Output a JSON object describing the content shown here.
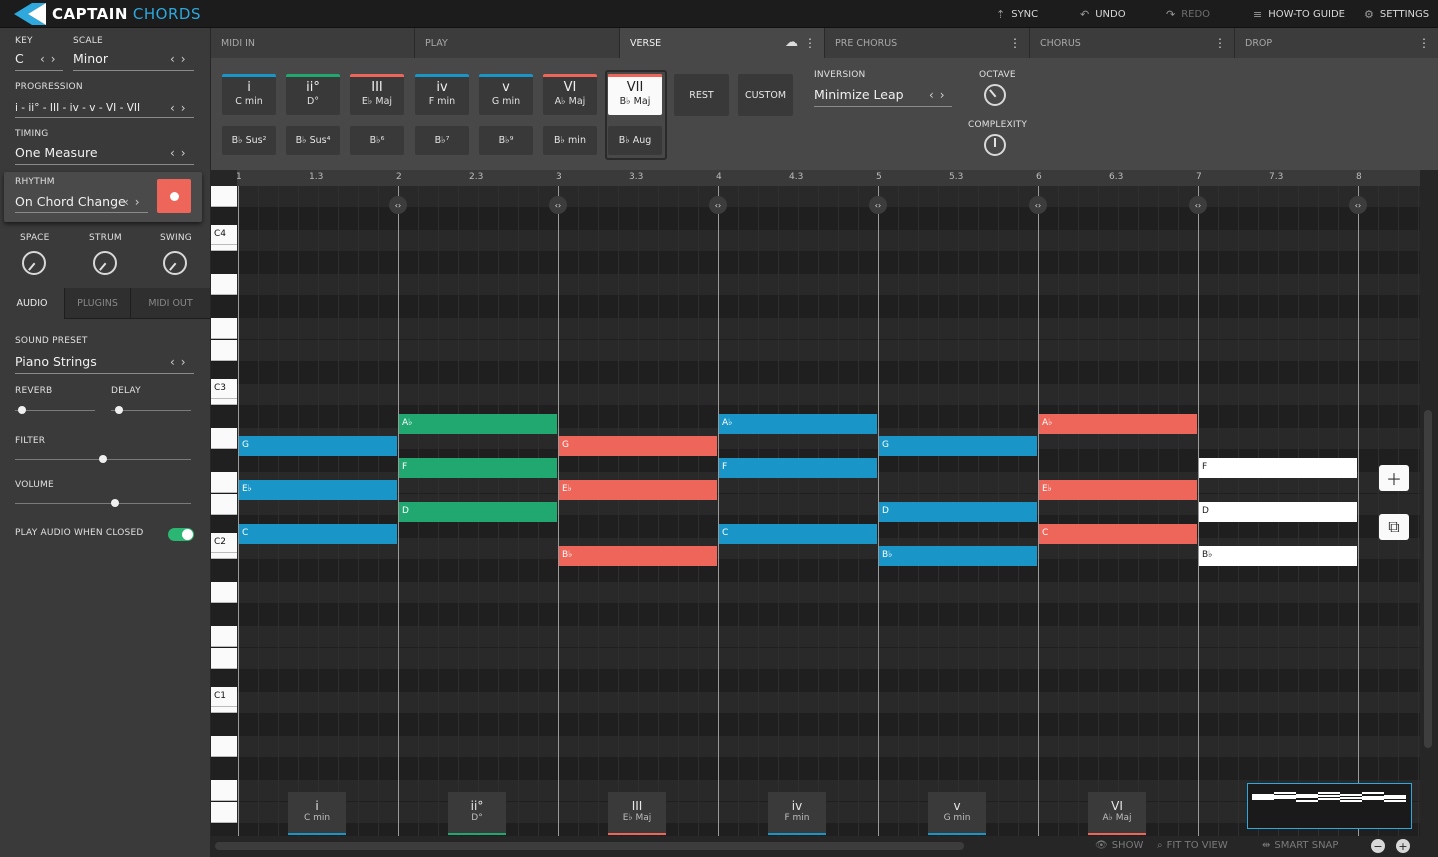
{
  "app": {
    "name_part1": "CAPTAIN",
    "name_part2": "CHORDS"
  },
  "topbar": {
    "sync": "SYNC",
    "undo": "UNDO",
    "redo": "REDO",
    "guide": "HOW-TO GUIDE",
    "settings": "SETTINGS"
  },
  "left": {
    "key_label": "KEY",
    "key_value": "C",
    "scale_label": "SCALE",
    "scale_value": "Minor",
    "progression_label": "PROGRESSION",
    "progression_value": "i - ii° - III - iv - v - VI - VII",
    "timing_label": "TIMING",
    "timing_value": "One Measure",
    "rhythm_label": "RHYTHM",
    "rhythm_value": "On Chord Change",
    "knobs": [
      "SPACE",
      "STRUM",
      "SWING"
    ],
    "tabs": [
      "AUDIO",
      "PLUGINS",
      "MIDI OUT"
    ],
    "sound_preset_label": "SOUND PRESET",
    "sound_preset_value": "Piano Strings",
    "reverb": "REVERB",
    "delay": "DELAY",
    "filter": "FILTER",
    "volume": "VOLUME",
    "reverb_level": 0.09,
    "delay_level": 0.1,
    "filter_level": 0.5,
    "volume_level": 0.57,
    "play_closed": "PLAY AUDIO WHEN CLOSED",
    "play_closed_on": true
  },
  "sections": [
    "MIDI IN",
    "PLAY",
    "VERSE",
    "PRE CHORUS",
    "CHORUS",
    "DROP"
  ],
  "palette": {
    "chords": [
      {
        "num": "i",
        "name": "C min",
        "color": "#1a95c8"
      },
      {
        "num": "ii°",
        "name": "D°",
        "color": "#21a871"
      },
      {
        "num": "III",
        "name": "E♭ Maj",
        "color": "#ee6559"
      },
      {
        "num": "iv",
        "name": "F min",
        "color": "#1a95c8"
      },
      {
        "num": "v",
        "name": "G min",
        "color": "#1a95c8"
      },
      {
        "num": "VI",
        "name": "A♭ Maj",
        "color": "#ee6559"
      },
      {
        "num": "VII",
        "name": "B♭ Maj",
        "color": "#ee6559"
      }
    ],
    "variations": [
      "B♭ Sus²",
      "B♭ Sus⁴",
      "B♭⁶",
      "B♭⁷",
      "B♭⁹",
      "B♭ min",
      "B♭ Aug"
    ],
    "rest": "REST",
    "custom": "CUSTOM",
    "inversion_label": "INVERSION",
    "inversion_value": "Minimize Leap",
    "octave_label": "OCTAVE",
    "complexity_label": "COMPLEXITY"
  },
  "ruler": [
    "1",
    "1.3",
    "2",
    "2.3",
    "3",
    "3.3",
    "4",
    "4.3",
    "5",
    "5.3",
    "6",
    "6.3",
    "7",
    "7.3",
    "8"
  ],
  "piano_labels": [
    "C4",
    "C3",
    "C2",
    "C1"
  ],
  "notes": [
    {
      "label": "G",
      "bar": 1,
      "row": 12,
      "color": "#1a95c8"
    },
    {
      "label": "E♭",
      "bar": 1,
      "row": 14,
      "color": "#1a95c8"
    },
    {
      "label": "C",
      "bar": 1,
      "row": 16,
      "color": "#1a95c8"
    },
    {
      "label": "A♭",
      "bar": 2,
      "row": 11,
      "color": "#21a871"
    },
    {
      "label": "F",
      "bar": 2,
      "row": 13,
      "color": "#21a871"
    },
    {
      "label": "D",
      "bar": 2,
      "row": 15,
      "color": "#21a871"
    },
    {
      "label": "G",
      "bar": 3,
      "row": 12,
      "color": "#ee6559"
    },
    {
      "label": "E♭",
      "bar": 3,
      "row": 14,
      "color": "#ee6559"
    },
    {
      "label": "B♭",
      "bar": 3,
      "row": 17,
      "color": "#ee6559"
    },
    {
      "label": "A♭",
      "bar": 4,
      "row": 11,
      "color": "#1a95c8"
    },
    {
      "label": "F",
      "bar": 4,
      "row": 13,
      "color": "#1a95c8"
    },
    {
      "label": "C",
      "bar": 4,
      "row": 16,
      "color": "#1a95c8"
    },
    {
      "label": "G",
      "bar": 5,
      "row": 12,
      "color": "#1a95c8"
    },
    {
      "label": "D",
      "bar": 5,
      "row": 15,
      "color": "#1a95c8"
    },
    {
      "label": "B♭",
      "bar": 5,
      "row": 17,
      "color": "#1a95c8"
    },
    {
      "label": "A♭",
      "bar": 6,
      "row": 11,
      "color": "#ee6559"
    },
    {
      "label": "E♭",
      "bar": 6,
      "row": 14,
      "color": "#ee6559"
    },
    {
      "label": "C",
      "bar": 6,
      "row": 16,
      "color": "#ee6559"
    },
    {
      "label": "F",
      "bar": 7,
      "row": 13,
      "color": "#ffffff"
    },
    {
      "label": "D",
      "bar": 7,
      "row": 15,
      "color": "#ffffff"
    },
    {
      "label": "B♭",
      "bar": 7,
      "row": 17,
      "color": "#ffffff"
    }
  ],
  "bottom_chords": [
    {
      "num": "i",
      "name": "C min",
      "color": "#1a95c8"
    },
    {
      "num": "ii°",
      "name": "D°",
      "color": "#21a871"
    },
    {
      "num": "III",
      "name": "E♭ Maj",
      "color": "#ee6559"
    },
    {
      "num": "iv",
      "name": "F min",
      "color": "#1a95c8"
    },
    {
      "num": "v",
      "name": "G min",
      "color": "#1a95c8"
    },
    {
      "num": "VI",
      "name": "A♭ Maj",
      "color": "#ee6559"
    }
  ],
  "bottombar": {
    "show": "SHOW",
    "fit": "FIT TO VIEW",
    "snap": "SMART SNAP"
  }
}
